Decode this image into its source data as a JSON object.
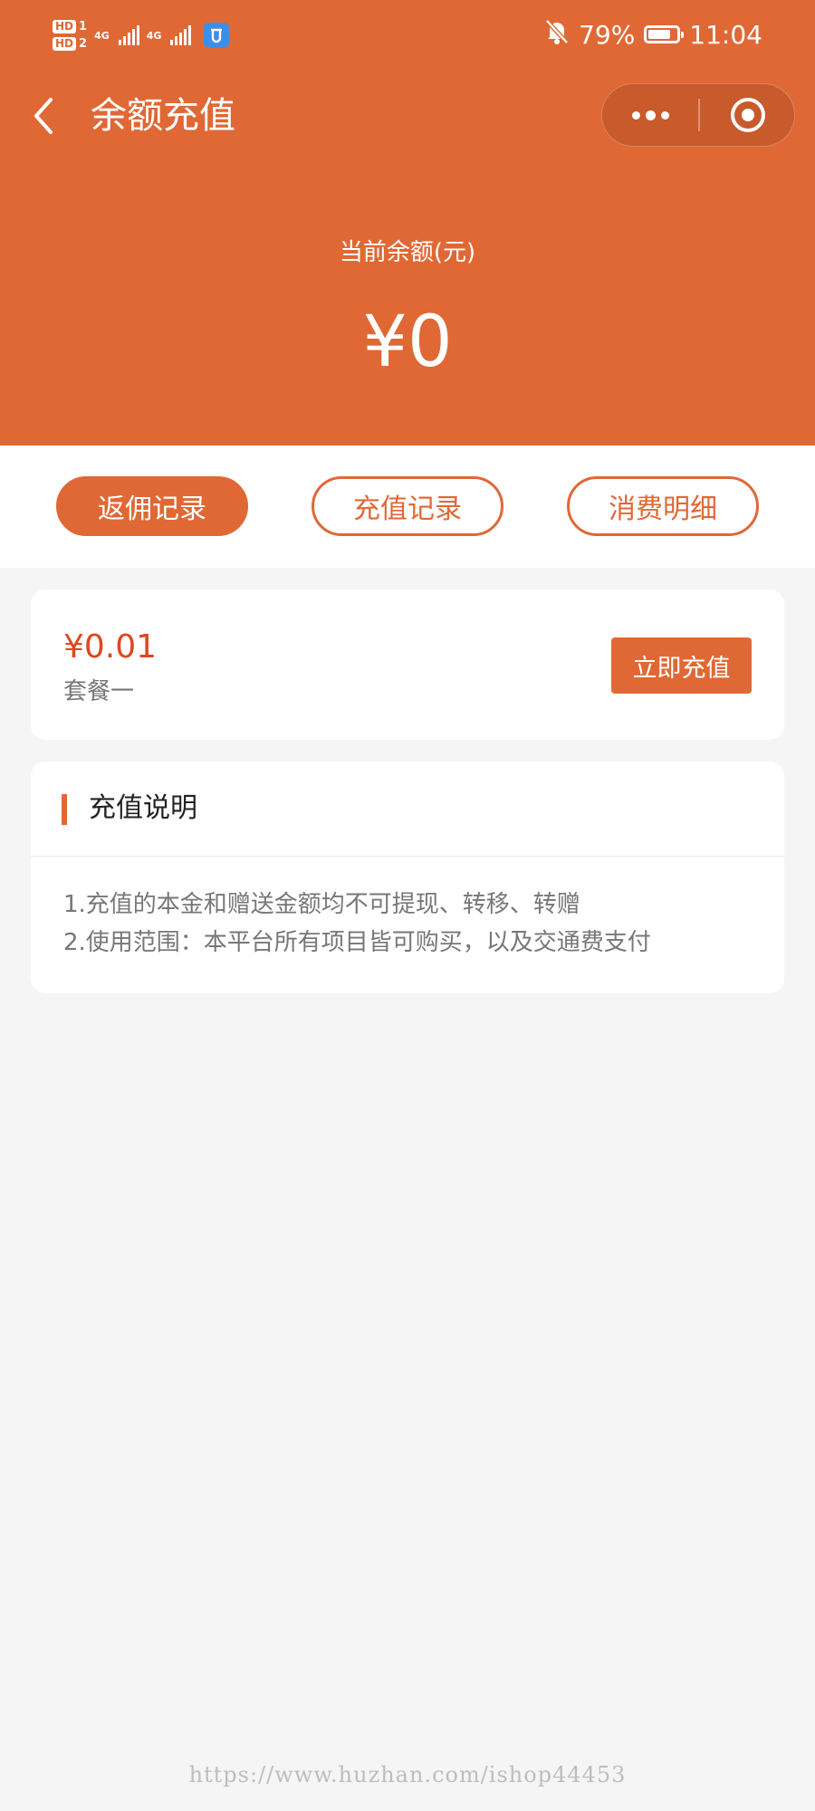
{
  "status_bar": {
    "sim1": "HD",
    "sim1_num": "1",
    "sim2": "HD",
    "sim2_num": "2",
    "net1": "4G",
    "net2": "4G",
    "battery_percent": "79%",
    "battery_level": 0.79,
    "time": "11:04",
    "icons": [
      "signal-icon",
      "app-notification-icon",
      "mute-bell-icon",
      "battery-icon"
    ]
  },
  "nav": {
    "title": "余额充值"
  },
  "balance": {
    "label": "当前余额(元)",
    "value": "¥0"
  },
  "tabs": [
    {
      "label": "返佣记录",
      "active": true
    },
    {
      "label": "充值记录",
      "active": false
    },
    {
      "label": "消费明细",
      "active": false
    }
  ],
  "package": {
    "price": "¥0.01",
    "name": "套餐一",
    "button_label": "立即充值"
  },
  "notes": {
    "title": "充值说明",
    "lines": [
      "1.充值的本金和赠送金额均不可提现、转移、转赠",
      "2.使用范围：本平台所有项目皆可购买，以及交通费支付"
    ]
  },
  "watermark": "https://www.huzhan.com/ishop44453",
  "colors": {
    "primary": "#e06835",
    "price": "#e0461e",
    "background": "#f5f5f5"
  }
}
